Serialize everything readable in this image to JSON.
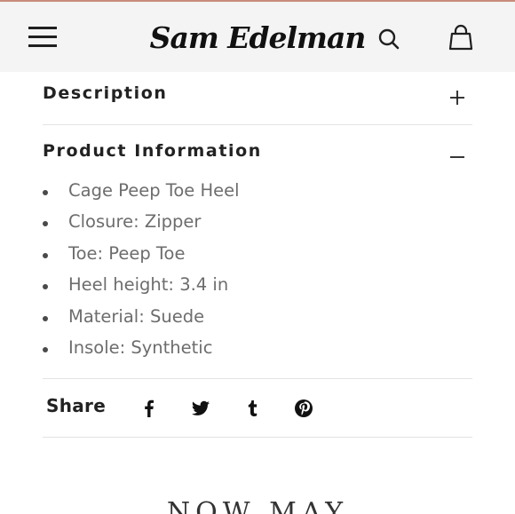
{
  "header": {
    "brand": "Sam Edelman",
    "icons": [
      "menu-icon",
      "search-icon",
      "bag-icon"
    ]
  },
  "description": {
    "title": "Description",
    "toggle_symbol": "+"
  },
  "product_information": {
    "title": "Product Information",
    "toggle_symbol": "–",
    "items": [
      "Cage Peep Toe Heel",
      "Closure: Zipper",
      "Toe: Peep Toe",
      "Heel height: 3.4 in",
      "Material: Suede",
      "Insole: Synthetic"
    ]
  },
  "share": {
    "label": "Share",
    "networks": [
      "facebook-icon",
      "twitter-icon",
      "tumblr-icon",
      "pinterest-icon"
    ]
  },
  "footer": {
    "partial_text": "NOW MAY"
  },
  "colors": {
    "header_bg": "#f4f4f4",
    "accent_line": "#c98a7a",
    "bullet_text": "#6d6d6d",
    "divider": "#e3e3e3"
  }
}
